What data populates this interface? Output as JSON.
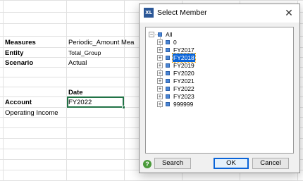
{
  "sheet": {
    "rows": [
      {
        "label": "Measures",
        "value": "Periodic_Amount Mea"
      },
      {
        "label": "Entity",
        "value": "Total_Group"
      },
      {
        "label": "Scenario",
        "value": "Actual"
      }
    ],
    "date_header": "Date",
    "account_label": "Account",
    "account_value": "FY2022",
    "operating_income": "Operating Income"
  },
  "dialog": {
    "app_icon_text": "XL",
    "title": "Select Member",
    "close_glyph": "✕",
    "tree": {
      "root": {
        "label": "All",
        "expander": "−"
      },
      "children": [
        {
          "label": "0",
          "expander": "+",
          "selected": false
        },
        {
          "label": "FY2017",
          "expander": "+",
          "selected": false
        },
        {
          "label": "FY2018",
          "expander": "+",
          "selected": true
        },
        {
          "label": "FY2019",
          "expander": "+",
          "selected": false
        },
        {
          "label": "FY2020",
          "expander": "+",
          "selected": false
        },
        {
          "label": "FY2021",
          "expander": "+",
          "selected": false
        },
        {
          "label": "FY2022",
          "expander": "+",
          "selected": false
        },
        {
          "label": "FY2023",
          "expander": "+",
          "selected": false
        },
        {
          "label": "999999",
          "expander": "+",
          "selected": false
        }
      ]
    },
    "help_glyph": "?",
    "buttons": {
      "search": "Search",
      "ok": "OK",
      "cancel": "Cancel"
    }
  },
  "colors": {
    "selection_border": "#217346",
    "tree_selected_bg": "#0a64d8",
    "node_icon": "#4a86d6",
    "help_icon": "#4a9a3a"
  },
  "icons": {
    "app": "xl-app-icon",
    "close": "close-icon",
    "help": "help-icon",
    "node": "member-node-icon"
  }
}
